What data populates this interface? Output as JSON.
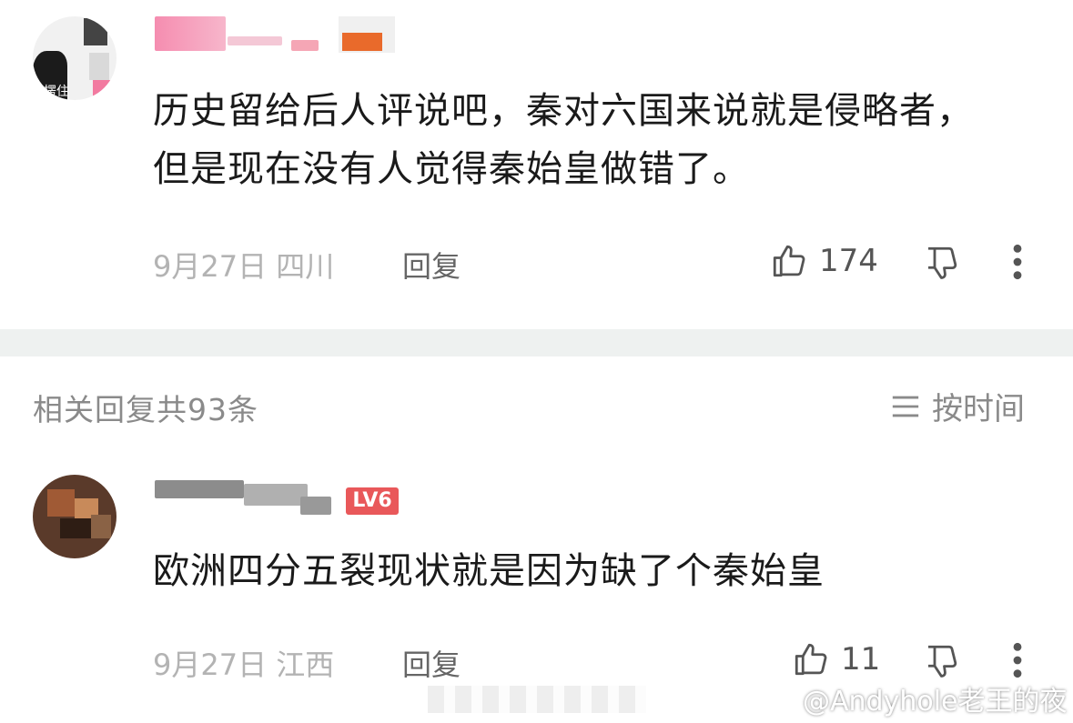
{
  "comments": [
    {
      "text": "历史留给后人评说吧，秦对六国来说就是侵略者，但是现在没有人觉得秦始皇做错了。",
      "avatar_caption": "楞住",
      "date": "9月27日",
      "location": "四川",
      "reply_label": "回复",
      "likes": "174"
    },
    {
      "text": "欧洲四分五裂现状就是因为缺了个秦始皇",
      "level_badge": "LV6",
      "date": "9月27日",
      "location": "江西",
      "reply_label": "回复",
      "likes": "11"
    }
  ],
  "replies_header": {
    "count_label": "相关回复共93条",
    "sort_label": "按时间"
  },
  "watermark": {
    "text": "@Andyhole老王的夜"
  },
  "icons": [
    "thumb-up-icon",
    "thumb-down-icon",
    "more-vertical-icon",
    "sort-lines-icon",
    "weibo-logo-icon"
  ]
}
